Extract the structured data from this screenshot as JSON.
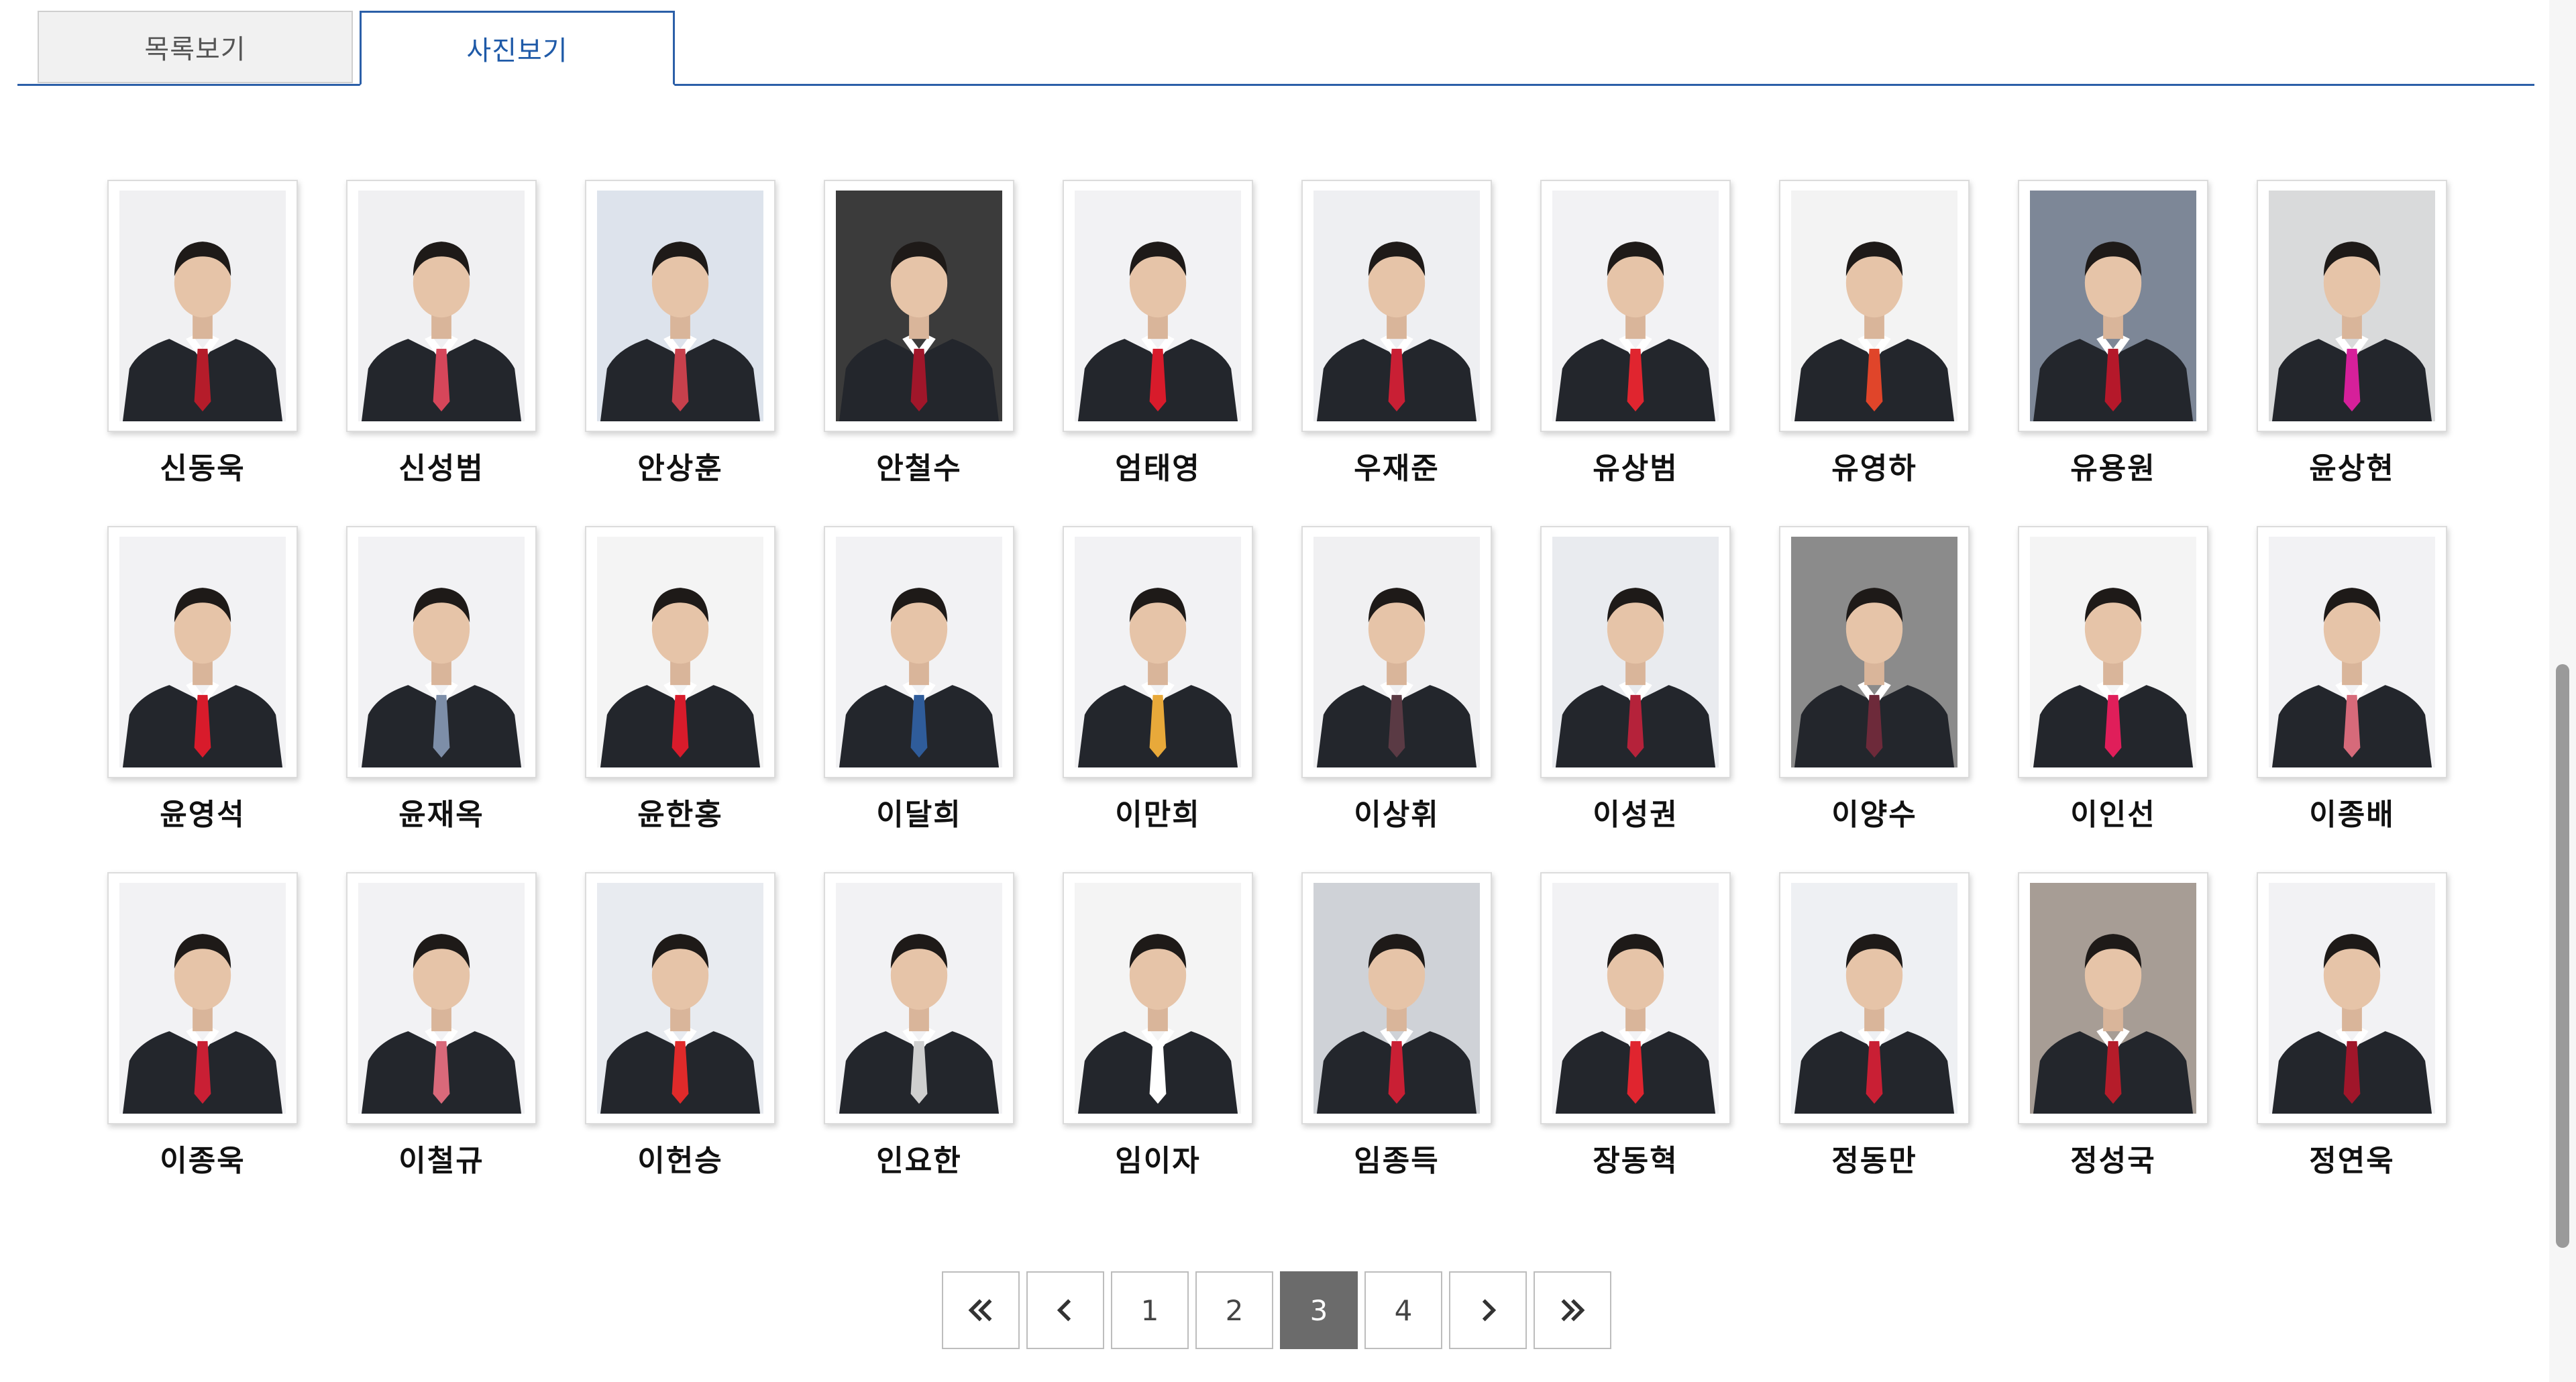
{
  "tabs": [
    {
      "label": "목록보기",
      "active": false
    },
    {
      "label": "사진보기",
      "active": true
    }
  ],
  "members": [
    {
      "name": "신동욱",
      "bg": "#f0f0f2",
      "tie": "#b51c2a"
    },
    {
      "name": "신성범",
      "bg": "#f0f0f2",
      "tie": "#d6465a"
    },
    {
      "name": "안상훈",
      "bg": "#dde3ec",
      "tie": "#c8404c"
    },
    {
      "name": "안철수",
      "bg": "#3b3b3b",
      "tie": "#a0162a"
    },
    {
      "name": "엄태영",
      "bg": "#f2f2f4",
      "tie": "#d81b2b"
    },
    {
      "name": "우재준",
      "bg": "#eeeff2",
      "tie": "#c91f34"
    },
    {
      "name": "유상범",
      "bg": "#f2f2f4",
      "tie": "#e0252f"
    },
    {
      "name": "유영하",
      "bg": "#f3f3f3",
      "tie": "#e0452a"
    },
    {
      "name": "유용원",
      "bg": "#7d8797",
      "tie": "#b5182a"
    },
    {
      "name": "윤상현",
      "bg": "#d9dadb",
      "tie": "#d6209a"
    },
    {
      "name": "윤영석",
      "bg": "#f2f2f4",
      "tie": "#d81b2b"
    },
    {
      "name": "윤재옥",
      "bg": "#f2f2f4",
      "tie": "#7d8ea8"
    },
    {
      "name": "윤한홍",
      "bg": "#f4f4f4",
      "tie": "#d81b2b"
    },
    {
      "name": "이달희",
      "bg": "#f2f2f4",
      "tie": "#2f5c9a"
    },
    {
      "name": "이만희",
      "bg": "#f2f2f4",
      "tie": "#e8a93a"
    },
    {
      "name": "이상휘",
      "bg": "#f0f0f2",
      "tie": "#5a3a44"
    },
    {
      "name": "이성권",
      "bg": "#e9ebef",
      "tie": "#b5223a"
    },
    {
      "name": "이양수",
      "bg": "#8b8b8b",
      "tie": "#6d2a3a"
    },
    {
      "name": "이인선",
      "bg": "#f4f4f4",
      "tie": "#e01e5a"
    },
    {
      "name": "이종배",
      "bg": "#f2f2f4",
      "tie": "#d66a7a"
    },
    {
      "name": "이종욱",
      "bg": "#f2f2f4",
      "tie": "#c91f34"
    },
    {
      "name": "이철규",
      "bg": "#f2f2f4",
      "tie": "#d9697a"
    },
    {
      "name": "이헌승",
      "bg": "#e8ebf0",
      "tie": "#e02a2a"
    },
    {
      "name": "인요한",
      "bg": "#f2f2f4",
      "tie": "#cfcfcf"
    },
    {
      "name": "임이자",
      "bg": "#f4f4f4",
      "tie": "#ffffff"
    },
    {
      "name": "임종득",
      "bg": "#cfd2d7",
      "tie": "#c91f34"
    },
    {
      "name": "장동혁",
      "bg": "#f2f2f4",
      "tie": "#e0252f"
    },
    {
      "name": "정동만",
      "bg": "#eef0f3",
      "tie": "#c91f34"
    },
    {
      "name": "정성국",
      "bg": "#a79d95",
      "tie": "#b51c2a"
    },
    {
      "name": "정연욱",
      "bg": "#f2f2f4",
      "tie": "#a0162a"
    }
  ],
  "pagination": {
    "first_icon": "double-chevron-left-icon",
    "prev_icon": "chevron-left-icon",
    "pages": [
      "1",
      "2",
      "3",
      "4"
    ],
    "current": "3",
    "next_icon": "chevron-right-icon",
    "last_icon": "double-chevron-right-icon"
  }
}
